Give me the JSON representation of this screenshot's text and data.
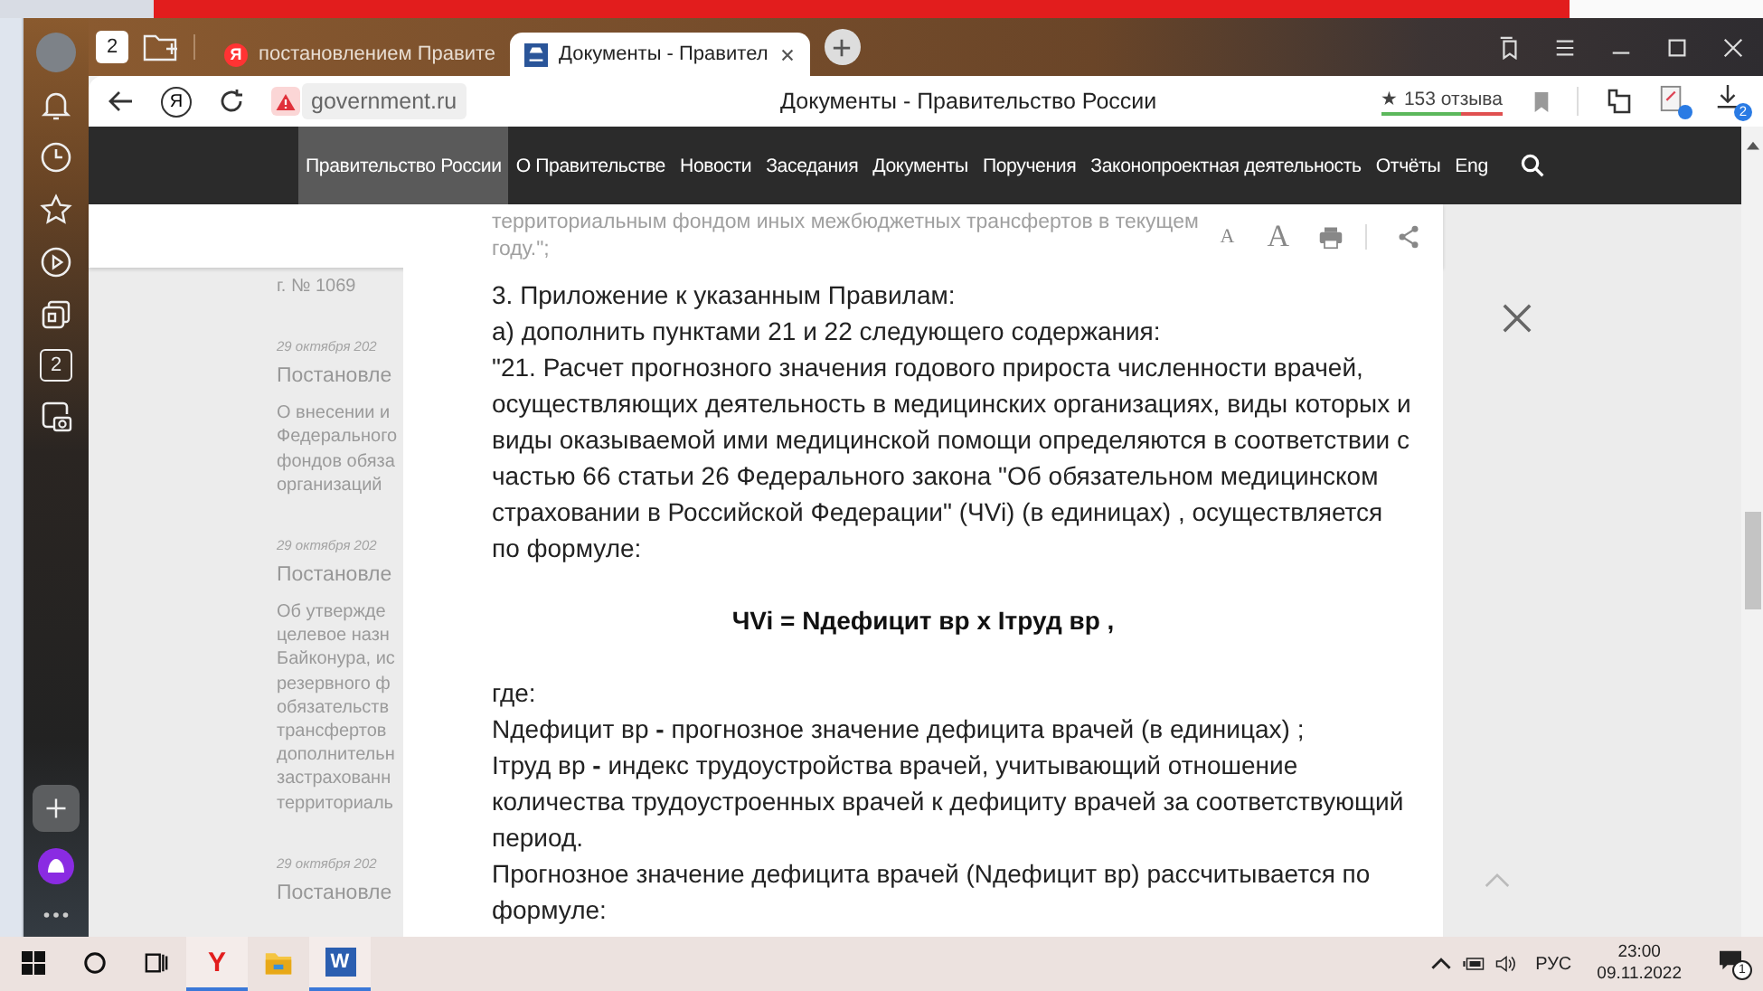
{
  "sidebar": {
    "items": [
      {
        "kind": "bell"
      },
      {
        "kind": "clock"
      },
      {
        "kind": "star"
      },
      {
        "kind": "play"
      },
      {
        "kind": "collections"
      },
      {
        "kind": "counter",
        "label": "2"
      },
      {
        "kind": "screenshot"
      }
    ],
    "bottom": [
      {
        "kind": "plus"
      },
      {
        "kind": "assistant"
      },
      {
        "kind": "more"
      }
    ]
  },
  "tab_bar": {
    "tab_count": "2",
    "tabs": [
      {
        "favicon_letter": "Я",
        "title": "постановлением Правите",
        "selected": false
      },
      {
        "title": "Документы - Правител",
        "selected": true
      }
    ]
  },
  "address_bar": {
    "assistant_letter": "Я",
    "domain": "government.ru",
    "page_title": "Документы - Правительство России",
    "rating": "★ 153 отзыва",
    "downloads_badge": "2"
  },
  "nav": {
    "items": [
      {
        "label": "Правительство России",
        "selected": true
      },
      {
        "label": "О Правительстве",
        "selected": false
      },
      {
        "label": "Новости",
        "selected": false
      },
      {
        "label": "Заседания",
        "selected": false
      },
      {
        "label": "Документы",
        "selected": false
      },
      {
        "label": "Поручения",
        "selected": false
      },
      {
        "label": "Законопроектная деятельность",
        "selected": false
      },
      {
        "label": "Отчёты",
        "selected": false
      },
      {
        "label": "Eng",
        "selected": false
      }
    ]
  },
  "background_list": [
    {
      "kind": "text",
      "text": "г. № 1069"
    },
    {
      "kind": "date",
      "text": "29 октября 202"
    },
    {
      "kind": "title",
      "text": "Постановле"
    },
    {
      "kind": "text",
      "text": "О внесении и"
    },
    {
      "kind": "text",
      "text": "Федерального"
    },
    {
      "kind": "text",
      "text": "фондов обяза"
    },
    {
      "kind": "text",
      "text": "организаций"
    },
    {
      "kind": "date",
      "text": "29 октября 202"
    },
    {
      "kind": "title",
      "text": "Постановле"
    },
    {
      "kind": "text",
      "text": "Об утвержде"
    },
    {
      "kind": "text",
      "text": "целевое назн"
    },
    {
      "kind": "text",
      "text": "Байконура, ис"
    },
    {
      "kind": "text",
      "text": "резервного ф"
    },
    {
      "kind": "text",
      "text": "обязательств"
    },
    {
      "kind": "text",
      "text": "трансфертов"
    },
    {
      "kind": "text",
      "text": "дополнительн"
    },
    {
      "kind": "text",
      "text": "застрахованн"
    },
    {
      "kind": "text",
      "text": "территориаль"
    },
    {
      "kind": "date",
      "text": "29 октября 202"
    },
    {
      "kind": "title",
      "text": "Постановле"
    }
  ],
  "document": {
    "toolbar": {
      "font_small": "A",
      "font_large": "A",
      "faded_lines": [
        "территориальным фондом иных межбюджетных трансфертов в текущем",
        "году.\";"
      ]
    },
    "lines": [
      {
        "kind": "text",
        "text": "3. Приложение к указанным Правилам:"
      },
      {
        "kind": "text",
        "text": "а)  дополнить пунктами 21 и 22 следующего содержания:"
      },
      {
        "kind": "text",
        "text": "\"21. Расчет прогнозного значения годового прироста численности врачей,"
      },
      {
        "kind": "text",
        "text": "осуществляющих деятельность в медицинских организациях, виды которых и"
      },
      {
        "kind": "text",
        "text": "виды оказываемой ими медицинской помощи определяются в соответствии с"
      },
      {
        "kind": "text",
        "text": "частью 66 статьи 26 Федерального закона \"Об обязательном медицинском"
      },
      {
        "kind": "text",
        "text": "страховании в Российской Федерации\" (ЧVi) (в единицах) , осуществляется"
      },
      {
        "kind": "text",
        "text": "по формуле:"
      },
      {
        "kind": "formula",
        "text": "ЧVi = Nдефицит вр x Iтруд вр ,"
      },
      {
        "kind": "text",
        "text": "где:"
      },
      {
        "kind": "text",
        "text": "Nдефицит вр **-** прогнозное значение дефицита врачей (в единицах) ;"
      },
      {
        "kind": "text",
        "text": "Iтруд вр **-** индекс трудоустройства врачей, учитывающий отношение"
      },
      {
        "kind": "text",
        "text": "количества трудоустроенных врачей к дефициту врачей за соответствующий"
      },
      {
        "kind": "text",
        "text": "период."
      },
      {
        "kind": "text",
        "text": "Прогнозное значение дефицита врачей (Nдефицит вр) рассчитывается по"
      },
      {
        "kind": "text",
        "text": "формуле:"
      }
    ]
  },
  "taskbar": {
    "apps": [
      {
        "kind": "start",
        "active": false
      },
      {
        "kind": "search",
        "active": false
      },
      {
        "kind": "taskview",
        "active": false
      },
      {
        "kind": "yandex",
        "label": "Y",
        "active": true
      },
      {
        "kind": "explorer",
        "active": false
      },
      {
        "kind": "word",
        "label": "W",
        "active": true
      }
    ],
    "language": "РУС",
    "time": "23:00",
    "date": "09.11.2022",
    "notifications": "1"
  }
}
